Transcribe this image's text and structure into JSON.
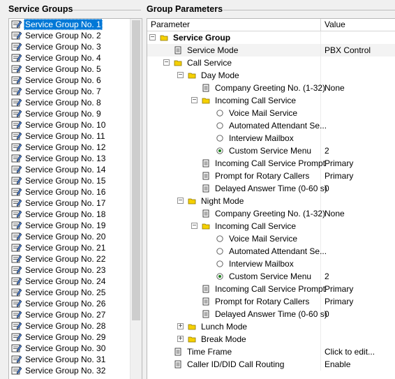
{
  "left_header": "Service Groups",
  "right_header": "Group Parameters",
  "service_groups": [
    "Service Group No. 1",
    "Service Group No. 2",
    "Service Group No. 3",
    "Service Group No. 4",
    "Service Group No. 5",
    "Service Group No. 6",
    "Service Group No. 7",
    "Service Group No. 8",
    "Service Group No. 9",
    "Service Group No. 10",
    "Service Group No. 11",
    "Service Group No. 12",
    "Service Group No. 13",
    "Service Group No. 14",
    "Service Group No. 15",
    "Service Group No. 16",
    "Service Group No. 17",
    "Service Group No. 18",
    "Service Group No. 19",
    "Service Group No. 20",
    "Service Group No. 21",
    "Service Group No. 22",
    "Service Group No. 23",
    "Service Group No. 24",
    "Service Group No. 25",
    "Service Group No. 26",
    "Service Group No. 27",
    "Service Group No. 28",
    "Service Group No. 29",
    "Service Group No. 30",
    "Service Group No. 31",
    "Service Group No. 32"
  ],
  "selected_group_index": 0,
  "columns": {
    "parameter": "Parameter",
    "value": "Value"
  },
  "tree_rows": [
    {
      "label": "Service Group",
      "value": "",
      "level": 0,
      "icon": "folder-icon",
      "expander": "minus",
      "bold": true
    },
    {
      "label": "Service Mode",
      "value": "PBX Control",
      "level": 1,
      "icon": "document-icon",
      "expander": "",
      "shade": true
    },
    {
      "label": "Call Service",
      "value": "",
      "level": 1,
      "icon": "folder-icon",
      "expander": "minus"
    },
    {
      "label": "Day Mode",
      "value": "",
      "level": 2,
      "icon": "folder-icon",
      "expander": "minus"
    },
    {
      "label": "Company Greeting No. (1-32)",
      "value": "None",
      "level": 3,
      "icon": "document-icon",
      "expander": ""
    },
    {
      "label": "Incoming Call Service",
      "value": "",
      "level": 3,
      "icon": "folder-icon",
      "expander": "minus"
    },
    {
      "label": "Voice Mail Service",
      "value": "",
      "level": 4,
      "icon": "radio-empty-icon",
      "expander": ""
    },
    {
      "label": "Automated Attendant Se...",
      "value": "",
      "level": 4,
      "icon": "radio-empty-icon",
      "expander": ""
    },
    {
      "label": "Interview Mailbox",
      "value": "",
      "level": 4,
      "icon": "radio-empty-icon",
      "expander": ""
    },
    {
      "label": "Custom Service Menu",
      "value": "2",
      "level": 4,
      "icon": "radio-selected-icon",
      "expander": ""
    },
    {
      "label": "Incoming Call Service Prompt",
      "value": "Primary",
      "level": 3,
      "icon": "document-icon",
      "expander": ""
    },
    {
      "label": "Prompt for Rotary Callers",
      "value": "Primary",
      "level": 3,
      "icon": "document-icon",
      "expander": ""
    },
    {
      "label": "Delayed Answer Time (0-60 s)",
      "value": "0",
      "level": 3,
      "icon": "document-icon",
      "expander": ""
    },
    {
      "label": "Night Mode",
      "value": "",
      "level": 2,
      "icon": "folder-icon",
      "expander": "minus"
    },
    {
      "label": "Company Greeting No. (1-32)",
      "value": "None",
      "level": 3,
      "icon": "document-icon",
      "expander": ""
    },
    {
      "label": "Incoming Call Service",
      "value": "",
      "level": 3,
      "icon": "folder-icon",
      "expander": "minus"
    },
    {
      "label": "Voice Mail Service",
      "value": "",
      "level": 4,
      "icon": "radio-empty-icon",
      "expander": ""
    },
    {
      "label": "Automated Attendant Se...",
      "value": "",
      "level": 4,
      "icon": "radio-empty-icon",
      "expander": ""
    },
    {
      "label": "Interview Mailbox",
      "value": "",
      "level": 4,
      "icon": "radio-empty-icon",
      "expander": ""
    },
    {
      "label": "Custom Service Menu",
      "value": "2",
      "level": 4,
      "icon": "radio-selected-icon",
      "expander": ""
    },
    {
      "label": "Incoming Call Service Prompt",
      "value": "Primary",
      "level": 3,
      "icon": "document-icon",
      "expander": ""
    },
    {
      "label": "Prompt for Rotary Callers",
      "value": "Primary",
      "level": 3,
      "icon": "document-icon",
      "expander": ""
    },
    {
      "label": "Delayed Answer Time (0-60 s)",
      "value": "0",
      "level": 3,
      "icon": "document-icon",
      "expander": ""
    },
    {
      "label": "Lunch Mode",
      "value": "",
      "level": 2,
      "icon": "folder-icon",
      "expander": "plus"
    },
    {
      "label": "Break Mode",
      "value": "",
      "level": 2,
      "icon": "folder-icon",
      "expander": "plus"
    },
    {
      "label": "Time Frame",
      "value": "Click to edit...",
      "level": 1,
      "icon": "document-icon",
      "expander": ""
    },
    {
      "label": "Caller ID/DID Call Routing",
      "value": "Enable",
      "level": 1,
      "icon": "document-icon",
      "expander": ""
    }
  ],
  "colors": {
    "selection": "#0078d7",
    "folder": "#f5d000",
    "row_shade": "#f3f3f3"
  }
}
